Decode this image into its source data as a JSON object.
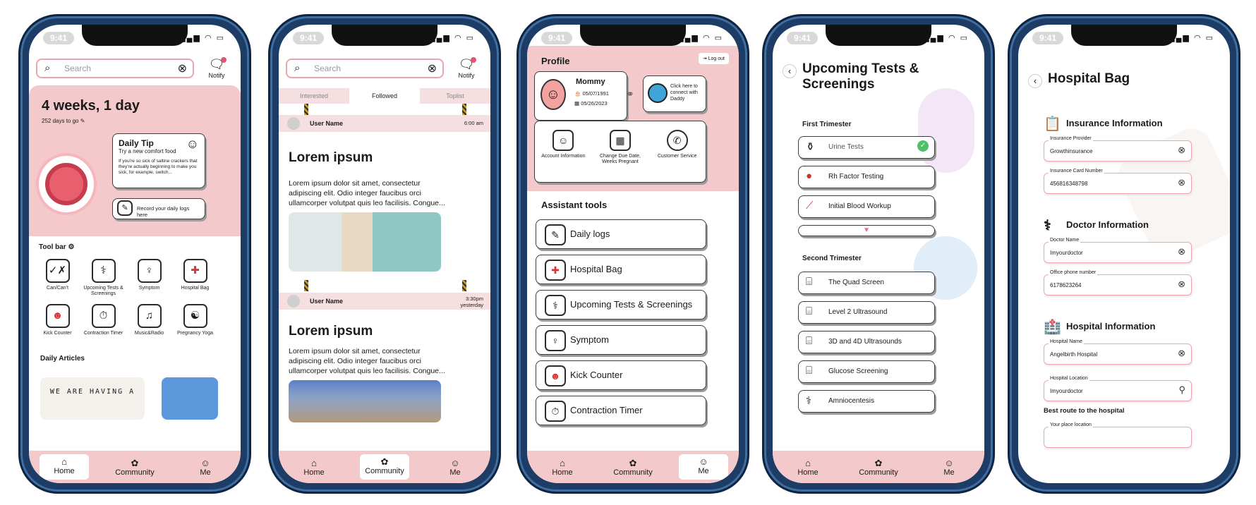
{
  "common": {
    "time": "9:41",
    "status_icons": "▂▄▆ ◠ ▭",
    "search_placeholder": "Search",
    "notify_label": "Notify",
    "nav": [
      {
        "label": "Home",
        "icon": "home-icon"
      },
      {
        "label": "Community",
        "icon": "community-icon"
      },
      {
        "label": "Me",
        "icon": "avatar-icon"
      }
    ]
  },
  "home": {
    "weeks": "4 weeks, 1 day",
    "days_to_go": "252 days to go",
    "daily_tip": {
      "title": "Daily Tip",
      "subtitle": "Try a new comfort food",
      "body": "If you're so sick of saltine crackers that they're actually beginning to make you sick, for example, switch..."
    },
    "record_logs": "Record your daily logs here",
    "toolbar_title": "Tool bar",
    "tools": [
      {
        "label": "Can/Can't",
        "icon": "can-cant-icon"
      },
      {
        "label": "Upcoming Tests & Screenings",
        "icon": "tests-icon"
      },
      {
        "label": "Symptom",
        "icon": "symptom-icon"
      },
      {
        "label": "Hospital Bag",
        "icon": "hospital-bag-icon"
      },
      {
        "label": "Kick Counter",
        "icon": "kick-counter-icon"
      },
      {
        "label": "Contraction Timer",
        "icon": "contraction-timer-icon"
      },
      {
        "label": "Music&Radio",
        "icon": "music-radio-icon"
      },
      {
        "label": "Pregnancy Yoga",
        "icon": "yoga-icon"
      }
    ],
    "daily_articles": "Daily Articles",
    "article_text": "WE ARE HAVING A"
  },
  "community": {
    "tabs": [
      "Interested",
      "Followed",
      "Toplist"
    ],
    "posts": [
      {
        "user": "User Name",
        "time": "6:00 am",
        "title": "Lorem ipsum",
        "body": "Lorem ipsum dolor sit amet, consectetur adipiscing elit. Odio integer faucibus orci ullamcorper volutpat quis leo facilisis. Congue..."
      },
      {
        "user": "User Name",
        "time": "3:30pm yesterday",
        "title": "Lorem ipsum",
        "body": "Lorem ipsum dolor sit amet, consectetur adipiscing elit. Odio integer faucibus orci ullamcorper volutpat quis leo facilisis. Congue..."
      }
    ]
  },
  "profile": {
    "title": "Profile",
    "logout": "Log out",
    "name": "Mommy",
    "birthday": "05/07/1991",
    "due_date": "05/26/2023",
    "connect": "Click here to connect with Daddy",
    "actions": [
      "Account Information",
      "Change Due Date, Weeks Pregnant",
      "Customer Service"
    ],
    "assistant_title": "Assistant tools",
    "assistant": [
      "Daily logs",
      "Hospital Bag",
      "Upcoming Tests & Screenings",
      "Symptom",
      "Kick Counter",
      "Contraction Timer"
    ]
  },
  "tests": {
    "title": "Upcoming Tests & Screenings",
    "first": "First Trimester",
    "first_items": [
      "Urine Tests",
      "Rh Factor Testing",
      "Initial Blood Workup"
    ],
    "second": "Second Trimester",
    "second_items": [
      "The Quad Screen",
      "Level 2 Ultrasound",
      "3D and 4D Ultrasounds",
      "Glucose Screening",
      "Amniocentesis"
    ]
  },
  "bag": {
    "title": "Hospital Bag",
    "insurance": "Insurance Information",
    "insurance_provider_label": "Insurance Provider",
    "insurance_provider": "Growthinsurance",
    "insurance_card_label": "Insurance Card Number",
    "insurance_card": "456816348798",
    "doctor": "Doctor Information",
    "doctor_name_label": "Doctor Name",
    "doctor_name": "Imyourdoctor",
    "office_phone_label": "Office phone number",
    "office_phone": "6178623264",
    "hospital": "Hospital Information",
    "hospital_name_label": "Hospital Name",
    "hospital_name": "Angelbirth Hospital",
    "hospital_location_label": "Hospital  Location",
    "hospital_location": "Imyourdoctor",
    "best_route": "Best route to the hospital",
    "your_place_label": "Your place location"
  },
  "colors": {
    "accent": "#f4c9cc",
    "field_border": "#f2a3ae",
    "check": "#4fbf6a"
  }
}
